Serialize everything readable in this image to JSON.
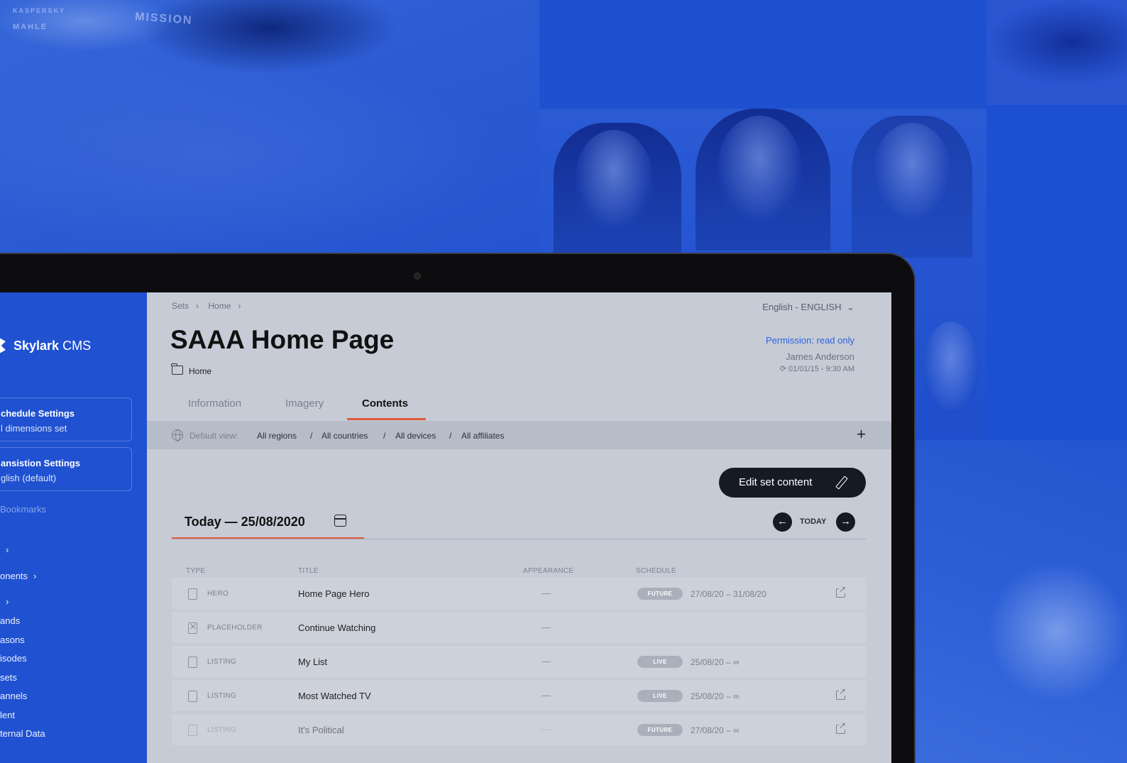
{
  "app": {
    "brand": "Skylark",
    "brand_suffix": "CMS"
  },
  "background": {
    "car_texts": [
      "MISSION",
      "KASPERSKY",
      "MAHLE"
    ]
  },
  "sidebar": {
    "cards": [
      {
        "title": "chedule Settings",
        "subtitle": "l dimensions set"
      },
      {
        "title": "ansistion Settings",
        "subtitle": "glish (default)"
      }
    ],
    "bookmarks_label": "Bookmarks",
    "items": [
      {
        "label": "",
        "chevron": "›"
      },
      {
        "label": "onents",
        "chevron": "›"
      },
      {
        "label": "",
        "chevron": "›"
      },
      {
        "label": "ands"
      },
      {
        "label": "asons"
      },
      {
        "label": "isodes"
      },
      {
        "label": "sets"
      },
      {
        "label": "annels"
      },
      {
        "label": "lent"
      },
      {
        "label": "ternal Data"
      }
    ]
  },
  "header": {
    "breadcrumb": [
      "Sets",
      "Home"
    ],
    "language": "English - ENGLISH",
    "title": "SAAA Home Page",
    "folder": "Home",
    "permission": "Permission: read only",
    "user": "James Anderson",
    "updated": "01/01/15 - 9:30 AM"
  },
  "tabs": [
    {
      "label": "Information"
    },
    {
      "label": "Imagery"
    },
    {
      "label": "Contents"
    }
  ],
  "filters": {
    "label": "Default view:",
    "values": [
      "All regions",
      "All countries",
      "All devices",
      "All affiliates"
    ],
    "separator": "/"
  },
  "toolbar": {
    "edit_label": "Edit set content",
    "date_label": "Today — 25/08/2020",
    "today_label": "TODAY"
  },
  "table": {
    "columns": [
      "TYPE",
      "TITLE",
      "APPEARANCE",
      "SCHEDULE"
    ],
    "rows": [
      {
        "type": "HERO",
        "title": "Home Page Hero",
        "appearance": "—",
        "status": "FUTURE",
        "schedule": "27/08/20 – 31/08/20",
        "has_link": true
      },
      {
        "type": "PLACEHOLDER",
        "title": "Continue Watching",
        "appearance": "—",
        "status": "",
        "schedule": "",
        "has_link": false
      },
      {
        "type": "LISTING",
        "title": "My List",
        "appearance": "—",
        "status": "LIVE",
        "schedule": "25/08/20 – ∞",
        "has_link": false
      },
      {
        "type": "LISTING",
        "title": "Most Watched TV",
        "appearance": "—",
        "status": "LIVE",
        "schedule": "25/08/20 – ∞",
        "has_link": true
      },
      {
        "type": "LISTING",
        "title": "It's Political",
        "appearance": "—",
        "status": "FUTURE",
        "schedule": "27/08/20 – ∞",
        "has_link": true
      }
    ]
  }
}
